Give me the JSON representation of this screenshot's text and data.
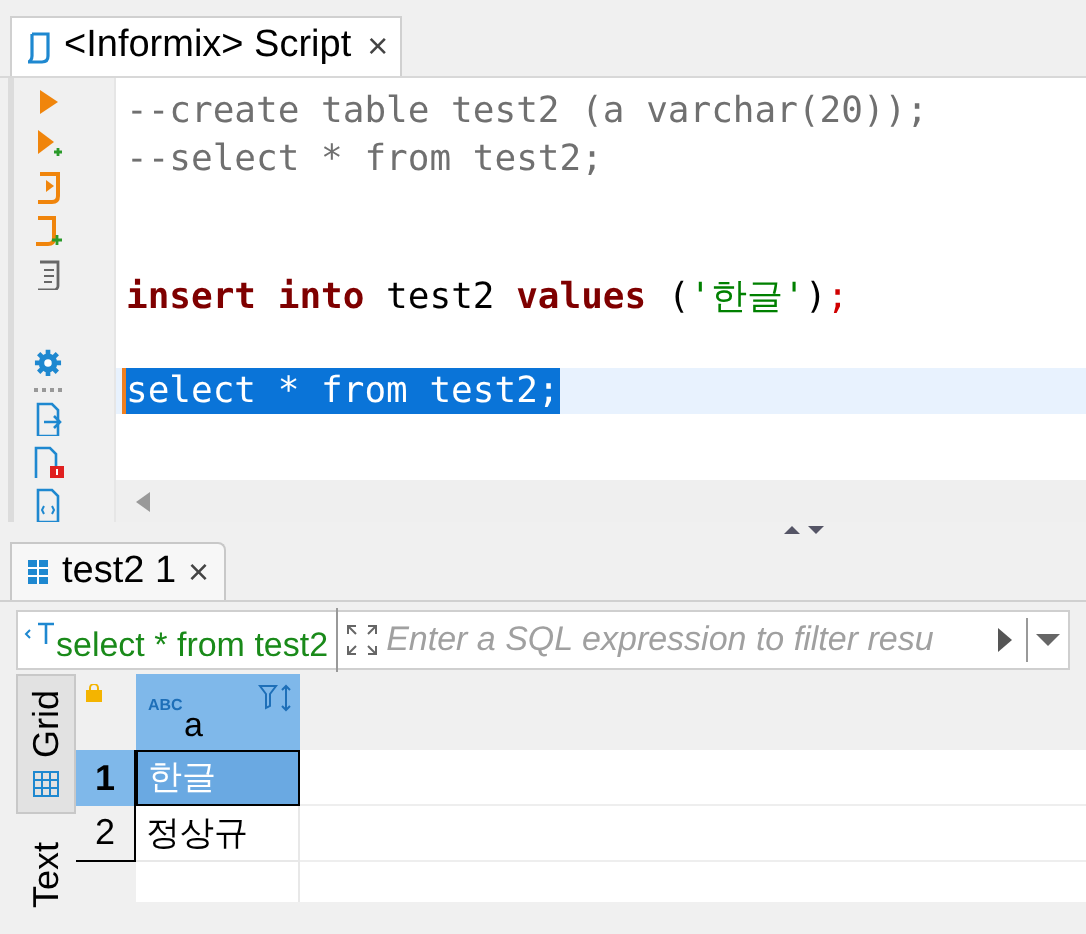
{
  "editor_tab": {
    "title": "<Informix> Script",
    "close": "×",
    "selected": true
  },
  "lines": [
    {
      "kind": "code",
      "selected": false,
      "segments": [
        {
          "kind": "comment",
          "text": "--create table test2 (a varchar(20));"
        }
      ]
    },
    {
      "kind": "code",
      "selected": false,
      "segments": [
        {
          "kind": "comment",
          "text": "--select * from test2;"
        }
      ]
    },
    {
      "kind": "blank"
    },
    {
      "kind": "blank"
    },
    {
      "kind": "code",
      "selected": false,
      "segments": [
        {
          "kind": "keyword",
          "text": "insert into"
        },
        {
          "kind": "plain",
          "text": " test2 "
        },
        {
          "kind": "keyword",
          "text": "values"
        },
        {
          "kind": "plain",
          "text": " ("
        },
        {
          "kind": "string",
          "text": "'한글'"
        },
        {
          "kind": "plain",
          "text": ")"
        },
        {
          "kind": "punct",
          "text": ";"
        }
      ]
    },
    {
      "kind": "blank"
    },
    {
      "kind": "code",
      "selected": true,
      "segments": [
        {
          "kind": "plain",
          "text": "select * from test2;"
        }
      ]
    }
  ],
  "results_tab": {
    "title": "test2 1",
    "close": "×",
    "selected": true
  },
  "filter": {
    "query": "select * from test2",
    "placeholder": "Enter a SQL expression to filter resu"
  },
  "view_tabs": [
    {
      "label": "Grid",
      "selected": true
    },
    {
      "label": "Text",
      "selected": false
    }
  ],
  "table": {
    "columns": [
      {
        "type_badge": "ABC",
        "name": "a"
      }
    ],
    "rows": [
      {
        "number": "1",
        "selected": true,
        "cells": [
          "한글"
        ]
      },
      {
        "number": "2",
        "selected": false,
        "cells": [
          "정상규"
        ]
      }
    ]
  }
}
